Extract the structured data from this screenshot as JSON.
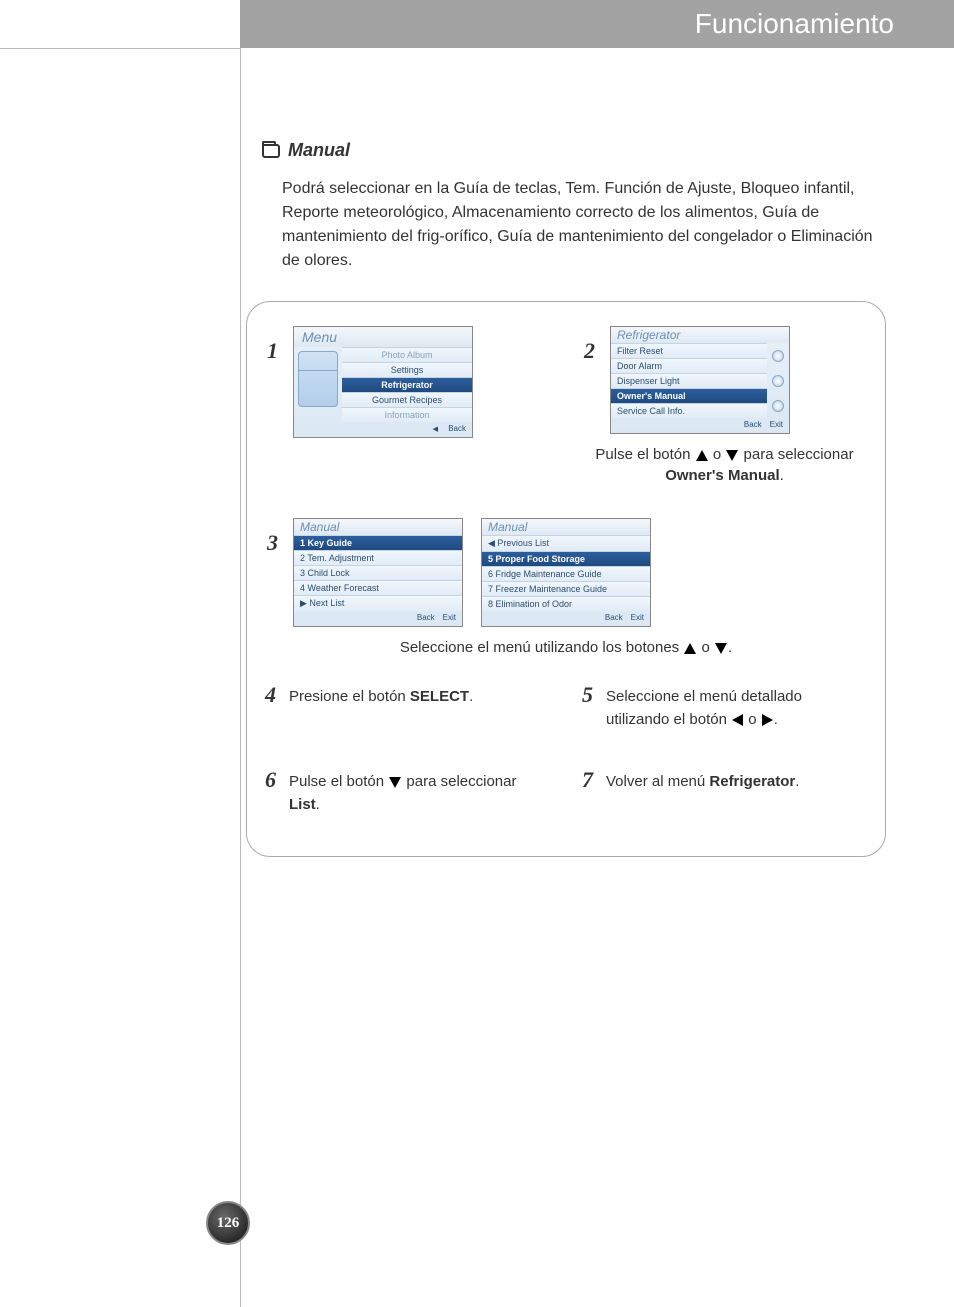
{
  "header": {
    "title": "Funcionamiento"
  },
  "section": {
    "title": "Manual"
  },
  "intro": "Podrá seleccionar en la Guía de teclas, Tem. Función de Ajuste, Bloqueo infantil, Reporte meteorológico, Almacenamiento correcto de los alimentos, Guía de mantenimiento del frig-orífico, Guía de mantenimiento del congelador o Eliminación de olores.",
  "steps": {
    "s1": {
      "num": "1",
      "screen": {
        "banner": "Menu",
        "items": [
          "Photo Album",
          "Settings",
          "Refrigerator",
          "Gourmet Recipes",
          "Information"
        ],
        "selected": "Refrigerator",
        "faded": [
          "Photo Album",
          "Information"
        ],
        "footer_back": "Back",
        "footer_back_arrow": "◀"
      }
    },
    "s2": {
      "num": "2",
      "screen": {
        "banner": "Refrigerator",
        "items": [
          "Filter Reset",
          "Door Alarm",
          "Dispenser Light",
          "Owner's Manual",
          "Service Call Info."
        ],
        "selected": "Owner's Manual",
        "footer_back": "Back",
        "footer_exit": "Exit"
      },
      "caption_pre": "Pulse el botón ",
      "caption_mid": " o ",
      "caption_post": " para seleccionar ",
      "caption_bold": "Owner's Manual",
      "caption_end": "."
    },
    "s3": {
      "num": "3",
      "screenA": {
        "banner": "Manual",
        "items": [
          "1 Key Guide",
          "2 Tem. Adjustment",
          "3 Child Lock",
          "4 Weather Forecast",
          "▶ Next List"
        ],
        "selected": "1 Key Guide",
        "footer_back": "Back",
        "footer_exit": "Exit"
      },
      "screenB": {
        "banner": "Manual",
        "items": [
          "◀ Previous List",
          "5 Proper Food Storage",
          "6 Fridge Maintenance Guide",
          "7 Freezer Maintenance Guide",
          "8 Elimination of Odor"
        ],
        "selected": "5 Proper Food Storage",
        "footer_back": "Back",
        "footer_exit": "Exit"
      },
      "caption_pre": "Seleccione el menú utilizando los botones ",
      "caption_mid": " o  ",
      "caption_end": "."
    },
    "s4": {
      "num": "4",
      "text_pre": "Presione el botón ",
      "text_bold": "SELECT",
      "text_end": "."
    },
    "s5": {
      "num": "5",
      "line1": "Seleccione el menú detallado",
      "line2_pre": "utilizando el botón ",
      "line2_mid": " o  ",
      "line2_end": "."
    },
    "s6": {
      "num": "6",
      "text_pre": "Pulse el botón ",
      "text_mid": " para seleccionar ",
      "text_bold": "List",
      "text_end": "."
    },
    "s7": {
      "num": "7",
      "text_pre": "Volver al menú ",
      "text_bold": "Refrigerator",
      "text_end": "."
    }
  },
  "page_number": "126"
}
